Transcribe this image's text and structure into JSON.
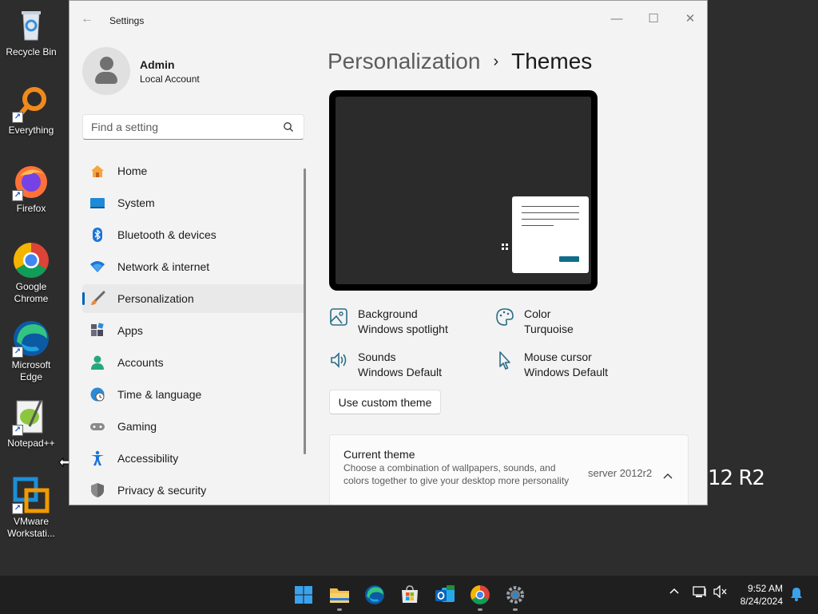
{
  "desktop": {
    "background_text": "12 R2",
    "icons": [
      {
        "label": "Recycle Bin",
        "icon": "recycle-bin-icon"
      },
      {
        "label": "Everything",
        "icon": "everything-search-icon"
      },
      {
        "label": "Firefox",
        "icon": "firefox-icon"
      },
      {
        "label": "Google Chrome",
        "icon": "chrome-icon"
      },
      {
        "label": "Microsoft Edge",
        "icon": "edge-icon"
      },
      {
        "label": "Notepad++",
        "icon": "notepadpp-icon"
      },
      {
        "label": "VMware Workstati...",
        "icon": "vmware-icon"
      }
    ]
  },
  "window": {
    "title": "Settings",
    "profile": {
      "name": "Admin",
      "type": "Local Account"
    },
    "search": {
      "placeholder": "Find a setting"
    },
    "nav": [
      {
        "label": "Home",
        "icon": "home-icon"
      },
      {
        "label": "System",
        "icon": "system-icon"
      },
      {
        "label": "Bluetooth & devices",
        "icon": "bluetooth-icon"
      },
      {
        "label": "Network & internet",
        "icon": "wifi-icon"
      },
      {
        "label": "Personalization",
        "icon": "brush-icon",
        "active": true
      },
      {
        "label": "Apps",
        "icon": "apps-icon"
      },
      {
        "label": "Accounts",
        "icon": "accounts-icon"
      },
      {
        "label": "Time & language",
        "icon": "clock-globe-icon"
      },
      {
        "label": "Gaming",
        "icon": "gamepad-icon"
      },
      {
        "label": "Accessibility",
        "icon": "accessibility-icon"
      },
      {
        "label": "Privacy & security",
        "icon": "shield-icon"
      }
    ],
    "breadcrumb": {
      "parent": "Personalization",
      "separator": "›",
      "current": "Themes"
    },
    "theme_props": {
      "background": {
        "title": "Background",
        "value": "Windows spotlight"
      },
      "color": {
        "title": "Color",
        "value": "Turquoise"
      },
      "sounds": {
        "title": "Sounds",
        "value": "Windows Default"
      },
      "cursor": {
        "title": "Mouse cursor",
        "value": "Windows Default"
      }
    },
    "custom_theme_button": "Use custom theme",
    "current_theme": {
      "title": "Current theme",
      "description": "Choose a combination of wallpapers, sounds, and colors together to give your desktop more personality",
      "value": "server 2012r2"
    }
  },
  "taskbar": {
    "apps": [
      "start-icon",
      "file-explorer-icon",
      "edge-icon",
      "store-icon",
      "outlook-icon",
      "chrome-icon",
      "settings-icon"
    ],
    "time": "9:52 AM",
    "date": "8/24/2024"
  },
  "colors": {
    "accent": "#005fb8",
    "preview_button": "#0f6d8a"
  }
}
